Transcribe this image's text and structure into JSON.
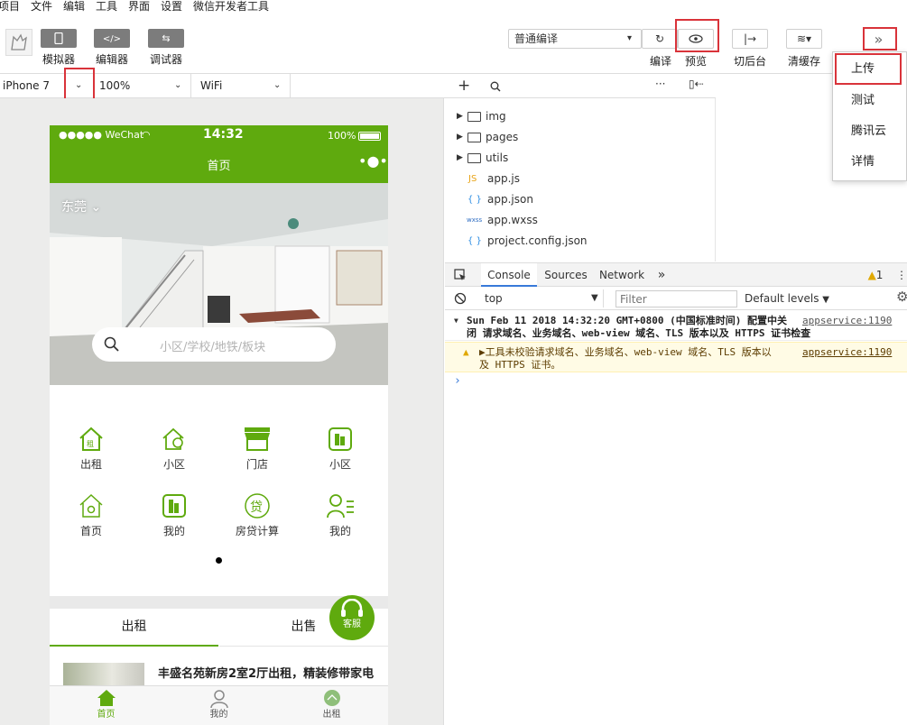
{
  "menubar": {
    "items": [
      "项目",
      "文件",
      "编辑",
      "工具",
      "界面",
      "设置",
      "微信开发者工具"
    ]
  },
  "toolbar": {
    "simulator_label": "模拟器",
    "editor_label": "编辑器",
    "debugger_label": "调试器",
    "compile_mode": "普通编译",
    "compile_label": "编译",
    "preview_label": "预览",
    "background_label": "切后台",
    "clear_cache_label": "清缓存"
  },
  "simbar": {
    "device": "iPhone 7",
    "zoom": "100%",
    "network": "WiFi"
  },
  "phone": {
    "carrier": "●●●●● WeChat",
    "time": "14:32",
    "battery": "100%",
    "nav_title": "首页",
    "city": "东莞",
    "search_placeholder": "小区/学校/地铁/板块",
    "grid": [
      {
        "label": "出租",
        "icon": "rent-house-icon"
      },
      {
        "label": "小区",
        "icon": "community-house-icon"
      },
      {
        "label": "门店",
        "icon": "store-icon"
      },
      {
        "label": "小区",
        "icon": "building-icon"
      },
      {
        "label": "首页",
        "icon": "home-icon"
      },
      {
        "label": "我的",
        "icon": "building-icon"
      },
      {
        "label": "房贷计算",
        "icon": "loan-icon"
      },
      {
        "label": "我的",
        "icon": "user-icon"
      }
    ],
    "tab_rent": "出租",
    "tab_sale": "出售",
    "service_label": "客服",
    "listing_title": "丰盛名苑新房2室2厅出租，精装修带家电",
    "bottom_tabs": [
      {
        "label": "首页",
        "icon": "home-filled-icon",
        "active": true
      },
      {
        "label": "我的",
        "icon": "person-icon",
        "active": false
      },
      {
        "label": "出租",
        "icon": "rent-icon",
        "active": false
      }
    ]
  },
  "filetree": {
    "items": [
      {
        "name": "img",
        "type": "folder"
      },
      {
        "name": "pages",
        "type": "folder"
      },
      {
        "name": "utils",
        "type": "folder"
      },
      {
        "name": "app.js",
        "type": "js"
      },
      {
        "name": "app.json",
        "type": "json"
      },
      {
        "name": "app.wxss",
        "type": "wxss"
      },
      {
        "name": "project.config.json",
        "type": "json"
      }
    ],
    "js_badge": "JS",
    "wxss_badge": "wxss",
    "json_badge": "{ }"
  },
  "devtools": {
    "tabs": [
      "Console",
      "Sources",
      "Network"
    ],
    "active_tab": "Console",
    "more": "»",
    "warning_count": "1",
    "context": "top",
    "filter_placeholder": "Filter",
    "levels": "Default levels",
    "log1_line1": "Sun Feb 11 2018 14:32:20 GMT+0800 (中国标准时间) 配置中关",
    "log1_line2": "闭 请求域名、业务域名、web-view 域名、TLS 版本以及 HTTPS 证书检查",
    "log1_source": "appservice:1190",
    "log2_line1": "▶工具未校验请求域名、业务域名、web-view 域名、TLS 版本以",
    "log2_line2": "及 HTTPS 证书。",
    "log2_source": "appservice:1190",
    "prompt": "›"
  },
  "dropdown": {
    "items": [
      "上传",
      "测试",
      "腾讯云",
      "详情"
    ]
  },
  "colors": {
    "brand_green": "#5faa0e",
    "highlight_red": "#d9333a",
    "warning_yellow": "#fffbe5"
  }
}
